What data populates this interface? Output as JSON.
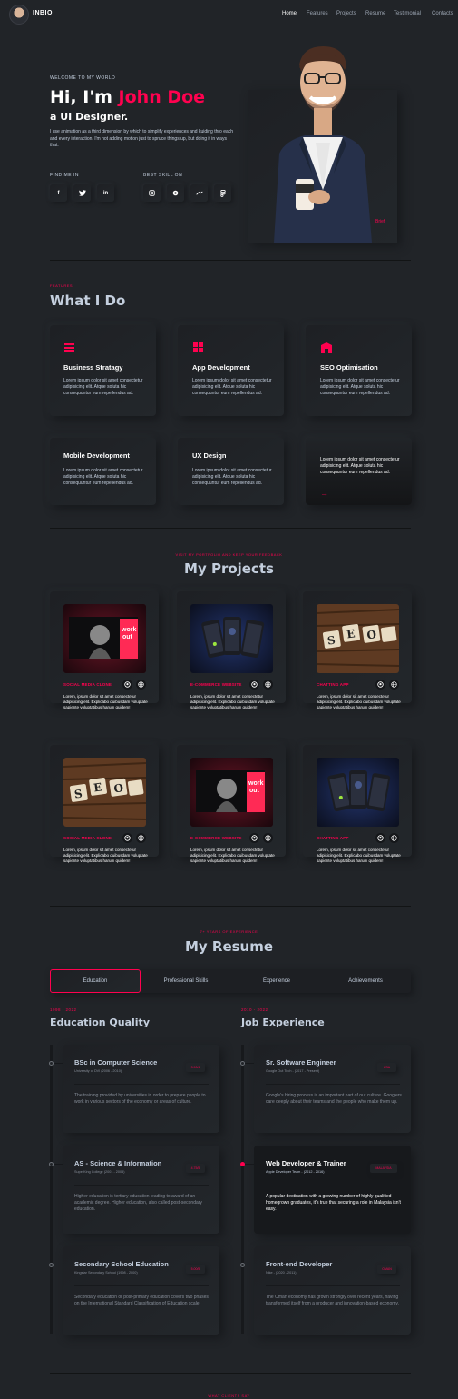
{
  "nav": {
    "brand": "INBIO",
    "items": [
      "Home",
      "Features",
      "Projects",
      "Resume",
      "Testimonial",
      "Contacts"
    ]
  },
  "hero": {
    "welcome": "WELCOME TO MY WORLD",
    "greeting": "Hi, I'm ",
    "name": "John Doe",
    "role": "a UI Designer.",
    "description": "I use animation as a third dimension by which to simplify experiences and kuiding thro each and every interaction. I'm not adding motion just to spruce things up, but doing it in ways that.",
    "find_me_label": "FIND ME IN",
    "social": [
      {
        "label": "f",
        "icon": "facebook-icon"
      },
      {
        "label": "t",
        "icon": "twitter-icon"
      },
      {
        "label": "in",
        "icon": "linkedin-icon"
      }
    ],
    "skill_label": "BEST SKILL ON",
    "skills": [
      {
        "icon": "camera-icon"
      },
      {
        "icon": "globe-icon"
      },
      {
        "icon": "cursor-icon"
      },
      {
        "icon": "figma-icon"
      }
    ],
    "photo_caption": "Brief"
  },
  "features": {
    "kicker": "FEATURES",
    "title": "What I Do",
    "services": [
      {
        "title": "Business Stratagy",
        "desc": "Lorem ipsum dolor sit amet consectetur adipisicing elit. Atque soluta hic consequuntur eum repellendus ad.",
        "icon": "menu-icon"
      },
      {
        "title": "App Development",
        "desc": "Lorem ipsum dolor sit amet consectetur adipisicing elit. Atque soluta hic consequuntur eum repellendus ad.",
        "icon": "grid-icon"
      },
      {
        "title": "SEO Optimisation",
        "desc": "Lorem ipsum dolor sit amet consectetur adipisicing elit. Atque soluta hic consequuntur eum repellendus ad.",
        "icon": "signal-icon"
      },
      {
        "title": "Mobile Development",
        "desc": "Lorem ipsum dolor sit amet consectetur adipisicing elit. Atque soluta hic consequuntur eum repellendus ad."
      },
      {
        "title": "UX Design",
        "desc": "Lorem ipsum dolor sit amet consectetur adipisicing elit. Atque soluta hic consequuntur eum repellendus ad."
      },
      {
        "title": "",
        "desc": "Lorem ipsum dolor sit amet consectetur adipisicing elit. Atque soluta hic consequuntur eum repellendus ad.",
        "arrow": "→"
      }
    ]
  },
  "projects": {
    "kicker": "VISIT MY PORTFOLIO AND KEEP YOUR FEEDBACK",
    "title": "My Projects",
    "desc": "Lorem, ipsum dolor sit amet consectetur adipisicing elit. Explicabo quibusdam voluptate sapiente voluptatibus harum quidem!",
    "items": [
      {
        "category": "SOCIAL MEDIA CLONE",
        "image": "workout"
      },
      {
        "category": "E-COMMERCE WEBSITE",
        "image": "phones"
      },
      {
        "category": "CHATTING APP",
        "image": "seo"
      },
      {
        "category": "SOCIAL MEDIA CLONE",
        "image": "seo"
      },
      {
        "category": "E-COMMERCE WEBSITE",
        "image": "workout"
      },
      {
        "category": "CHATTING APP",
        "image": "phones"
      }
    ],
    "workout_text": "work out"
  },
  "resume": {
    "kicker": "7+ YEARS OF EXPERIENCE",
    "title": "My Resume",
    "tabs": [
      "Education",
      "Professional Skills",
      "Experience",
      "Achievements"
    ],
    "education": {
      "years": "1998 - 2022",
      "title": "Education Quality",
      "items": [
        {
          "title": "BSc in Computer Science",
          "sub": "University of DVI (2006 - 2010)",
          "badge": "3.90/4",
          "desc": "The training provided by universities in order to prepare people to work in various sectors of the economy or areas of culture."
        },
        {
          "title": "AS - Science & Information",
          "sub": "SuperKing College (2001 - 2005)",
          "badge": "4.75/5",
          "desc": "Higher education is tertiary education leading to award of an academic degree. Higher education, also called post-secondary education."
        },
        {
          "title": "Secondary School Education",
          "sub": "Kingstar Secondary School (1998 - 2000)",
          "badge": "5.00/5",
          "desc": "Secondary education or post-primary education covers two phases on the International Standard Classification of Education scale."
        }
      ]
    },
    "experience": {
      "years": "2010 - 2022",
      "title": "Job Experience",
      "items": [
        {
          "title": "Sr. Software Engineer",
          "sub": "Google Out Tech - (2017 - Present)",
          "badge": "USA",
          "desc": "Google's hiring process is an important part of our culture. Googlers care deeply about their teams and the people who make them up."
        },
        {
          "title": "Web Developer & Trainer",
          "sub": "Apple Developer Team - (2012 - 2016)",
          "badge": "MALAYSIA",
          "desc": "A popular destination with a growing number of highly qualified homegrown graduates, it's true that securing a role in Malaysia isn't easy."
        },
        {
          "title": "Front-end Developer",
          "sub": "Nike - (2020 - 2011)",
          "badge": "OMAN",
          "desc": "The Oman economy has grown strongly over recent years, having transformed itself from a producer and innovation-based economy."
        }
      ]
    }
  },
  "footer_kicker": "WHAT CLIENTS SAY"
}
